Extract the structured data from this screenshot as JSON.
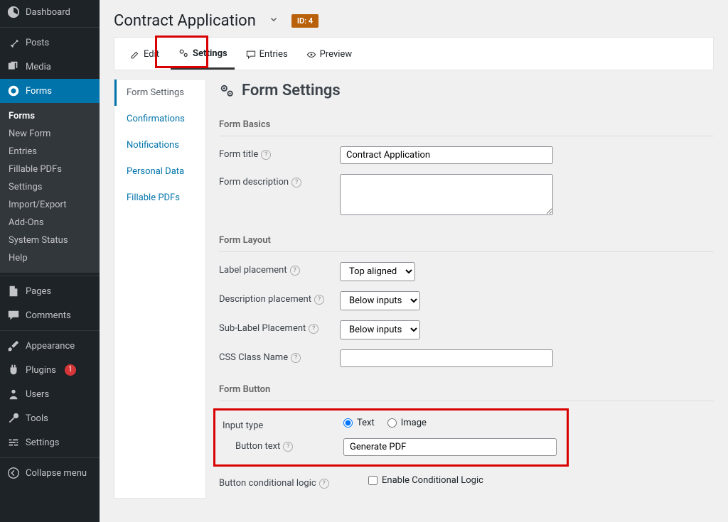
{
  "sidebar": {
    "items": [
      {
        "label": "Dashboard"
      },
      {
        "label": "Posts"
      },
      {
        "label": "Media"
      },
      {
        "label": "Forms"
      },
      {
        "label": "Pages"
      },
      {
        "label": "Comments"
      },
      {
        "label": "Appearance"
      },
      {
        "label": "Plugins",
        "badge": "1"
      },
      {
        "label": "Users"
      },
      {
        "label": "Tools"
      },
      {
        "label": "Settings"
      },
      {
        "label": "Collapse menu"
      }
    ],
    "forms_sub": [
      "Forms",
      "New Form",
      "Entries",
      "Fillable PDFs",
      "Settings",
      "Import/Export",
      "Add-Ons",
      "System Status",
      "Help"
    ]
  },
  "head": {
    "title": "Contract Application",
    "id_label": "ID: 4"
  },
  "tabs": [
    {
      "label": "Edit"
    },
    {
      "label": "Settings"
    },
    {
      "label": "Entries"
    },
    {
      "label": "Preview"
    }
  ],
  "subnav": [
    "Form Settings",
    "Confirmations",
    "Notifications",
    "Personal Data",
    "Fillable PDFs"
  ],
  "panel_title": "Form Settings",
  "sections": {
    "basics": {
      "heading": "Form Basics",
      "title_label": "Form title",
      "title_value": "Contract Application",
      "desc_label": "Form description",
      "desc_value": ""
    },
    "layout": {
      "heading": "Form Layout",
      "label_pl": "Label placement",
      "label_pl_val": "Top aligned",
      "desc_pl": "Description placement",
      "desc_pl_val": "Below inputs",
      "sub_pl": "Sub-Label Placement",
      "sub_pl_val": "Below inputs",
      "css": "CSS Class Name",
      "css_val": ""
    },
    "button": {
      "heading": "Form Button",
      "input_type": "Input type",
      "opt_text": "Text",
      "opt_image": "Image",
      "btn_text_label": "Button text",
      "btn_text_value": "Generate PDF",
      "cond_label": "Button conditional logic",
      "cond_cb": "Enable Conditional Logic"
    }
  }
}
